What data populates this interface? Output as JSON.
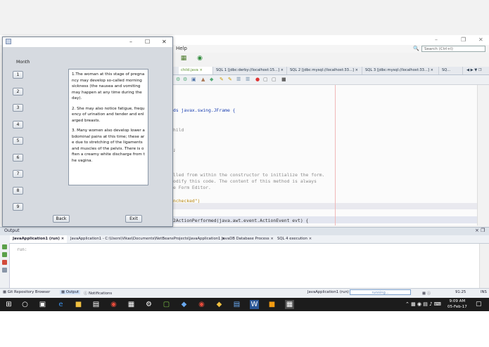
{
  "ide": {
    "menu_help": "Help",
    "search_placeholder": "Search (Ctrl+I)",
    "editor_tabs": [
      {
        "label": "child.java",
        "active": true
      },
      {
        "label": "SQL 1 [jdbc:derby://localhost:15...]",
        "active": false
      },
      {
        "label": "SQL 2 [jdbc:mysql://localhost:33...]",
        "active": false
      },
      {
        "label": "SQL 3 [jdbc:mysql://localhost:33...]",
        "active": false
      },
      {
        "label": "SQ...",
        "active": false
      }
    ],
    "code_lines": [
      "ds javax.swing.JFrame {",
      "hild",
      ";",
      "lled from within the constructor to initialize the form.",
      "odify this code. The content of this method is always",
      "e Form Editor.",
      "nchecked\")",
      "2ActionPerformed(java.awt.event.ActionEvent evt) {"
    ]
  },
  "output": {
    "title": "Output",
    "tabs": [
      {
        "label": "JavaApplication1 (run)",
        "active": true
      },
      {
        "label": "JavaApplication1 - C:\\Users\\Vikas\\Documents\\NetBeansProjects\\JavaApplication1",
        "active": false
      },
      {
        "label": "JavaDB Database Process",
        "active": false
      },
      {
        "label": "SQL 4 execution",
        "active": false
      }
    ],
    "text": "run:"
  },
  "statusbar": {
    "git": "Git Repository Browser",
    "output": "Output",
    "notifications": "Notifications",
    "app": "JavaApplication1 (run)",
    "progress": "running...",
    "position": "91:25",
    "mode": "INS"
  },
  "taskbar": {
    "time": "9:09 AM",
    "date": "05-Feb-17"
  },
  "app": {
    "month_label": "Month",
    "months": [
      "1",
      "2",
      "3",
      "4",
      "5",
      "6",
      "7",
      "8",
      "9"
    ],
    "info_paragraphs": [
      "1.The woman at this stage of pregnancy may develop so-called morning sickness (the nausea and vomiting may happen at any time during the day).",
      "2. She may also notice fatigue, frequency of urination and tender and enlarged breasts.",
      "3. Many women also develop lower abdominal pains at this time; these are due to stretching of the ligaments and muscles of the pelvis. There is often a creamy white discharge from the vagina."
    ],
    "back_label": "Back",
    "exit_label": "Exit"
  }
}
